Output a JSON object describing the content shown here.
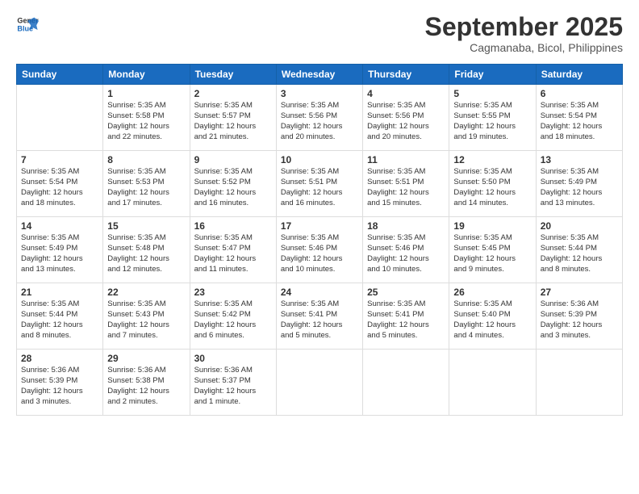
{
  "logo": {
    "line1": "General",
    "line2": "Blue"
  },
  "title": "September 2025",
  "subtitle": "Cagmanaba, Bicol, Philippines",
  "days_of_week": [
    "Sunday",
    "Monday",
    "Tuesday",
    "Wednesday",
    "Thursday",
    "Friday",
    "Saturday"
  ],
  "weeks": [
    [
      {
        "day": "",
        "info": ""
      },
      {
        "day": "1",
        "info": "Sunrise: 5:35 AM\nSunset: 5:58 PM\nDaylight: 12 hours\nand 22 minutes."
      },
      {
        "day": "2",
        "info": "Sunrise: 5:35 AM\nSunset: 5:57 PM\nDaylight: 12 hours\nand 21 minutes."
      },
      {
        "day": "3",
        "info": "Sunrise: 5:35 AM\nSunset: 5:56 PM\nDaylight: 12 hours\nand 20 minutes."
      },
      {
        "day": "4",
        "info": "Sunrise: 5:35 AM\nSunset: 5:56 PM\nDaylight: 12 hours\nand 20 minutes."
      },
      {
        "day": "5",
        "info": "Sunrise: 5:35 AM\nSunset: 5:55 PM\nDaylight: 12 hours\nand 19 minutes."
      },
      {
        "day": "6",
        "info": "Sunrise: 5:35 AM\nSunset: 5:54 PM\nDaylight: 12 hours\nand 18 minutes."
      }
    ],
    [
      {
        "day": "7",
        "info": "Sunrise: 5:35 AM\nSunset: 5:54 PM\nDaylight: 12 hours\nand 18 minutes."
      },
      {
        "day": "8",
        "info": "Sunrise: 5:35 AM\nSunset: 5:53 PM\nDaylight: 12 hours\nand 17 minutes."
      },
      {
        "day": "9",
        "info": "Sunrise: 5:35 AM\nSunset: 5:52 PM\nDaylight: 12 hours\nand 16 minutes."
      },
      {
        "day": "10",
        "info": "Sunrise: 5:35 AM\nSunset: 5:51 PM\nDaylight: 12 hours\nand 16 minutes."
      },
      {
        "day": "11",
        "info": "Sunrise: 5:35 AM\nSunset: 5:51 PM\nDaylight: 12 hours\nand 15 minutes."
      },
      {
        "day": "12",
        "info": "Sunrise: 5:35 AM\nSunset: 5:50 PM\nDaylight: 12 hours\nand 14 minutes."
      },
      {
        "day": "13",
        "info": "Sunrise: 5:35 AM\nSunset: 5:49 PM\nDaylight: 12 hours\nand 13 minutes."
      }
    ],
    [
      {
        "day": "14",
        "info": "Sunrise: 5:35 AM\nSunset: 5:49 PM\nDaylight: 12 hours\nand 13 minutes."
      },
      {
        "day": "15",
        "info": "Sunrise: 5:35 AM\nSunset: 5:48 PM\nDaylight: 12 hours\nand 12 minutes."
      },
      {
        "day": "16",
        "info": "Sunrise: 5:35 AM\nSunset: 5:47 PM\nDaylight: 12 hours\nand 11 minutes."
      },
      {
        "day": "17",
        "info": "Sunrise: 5:35 AM\nSunset: 5:46 PM\nDaylight: 12 hours\nand 10 minutes."
      },
      {
        "day": "18",
        "info": "Sunrise: 5:35 AM\nSunset: 5:46 PM\nDaylight: 12 hours\nand 10 minutes."
      },
      {
        "day": "19",
        "info": "Sunrise: 5:35 AM\nSunset: 5:45 PM\nDaylight: 12 hours\nand 9 minutes."
      },
      {
        "day": "20",
        "info": "Sunrise: 5:35 AM\nSunset: 5:44 PM\nDaylight: 12 hours\nand 8 minutes."
      }
    ],
    [
      {
        "day": "21",
        "info": "Sunrise: 5:35 AM\nSunset: 5:44 PM\nDaylight: 12 hours\nand 8 minutes."
      },
      {
        "day": "22",
        "info": "Sunrise: 5:35 AM\nSunset: 5:43 PM\nDaylight: 12 hours\nand 7 minutes."
      },
      {
        "day": "23",
        "info": "Sunrise: 5:35 AM\nSunset: 5:42 PM\nDaylight: 12 hours\nand 6 minutes."
      },
      {
        "day": "24",
        "info": "Sunrise: 5:35 AM\nSunset: 5:41 PM\nDaylight: 12 hours\nand 5 minutes."
      },
      {
        "day": "25",
        "info": "Sunrise: 5:35 AM\nSunset: 5:41 PM\nDaylight: 12 hours\nand 5 minutes."
      },
      {
        "day": "26",
        "info": "Sunrise: 5:35 AM\nSunset: 5:40 PM\nDaylight: 12 hours\nand 4 minutes."
      },
      {
        "day": "27",
        "info": "Sunrise: 5:36 AM\nSunset: 5:39 PM\nDaylight: 12 hours\nand 3 minutes."
      }
    ],
    [
      {
        "day": "28",
        "info": "Sunrise: 5:36 AM\nSunset: 5:39 PM\nDaylight: 12 hours\nand 3 minutes."
      },
      {
        "day": "29",
        "info": "Sunrise: 5:36 AM\nSunset: 5:38 PM\nDaylight: 12 hours\nand 2 minutes."
      },
      {
        "day": "30",
        "info": "Sunrise: 5:36 AM\nSunset: 5:37 PM\nDaylight: 12 hours\nand 1 minute."
      },
      {
        "day": "",
        "info": ""
      },
      {
        "day": "",
        "info": ""
      },
      {
        "day": "",
        "info": ""
      },
      {
        "day": "",
        "info": ""
      }
    ]
  ]
}
